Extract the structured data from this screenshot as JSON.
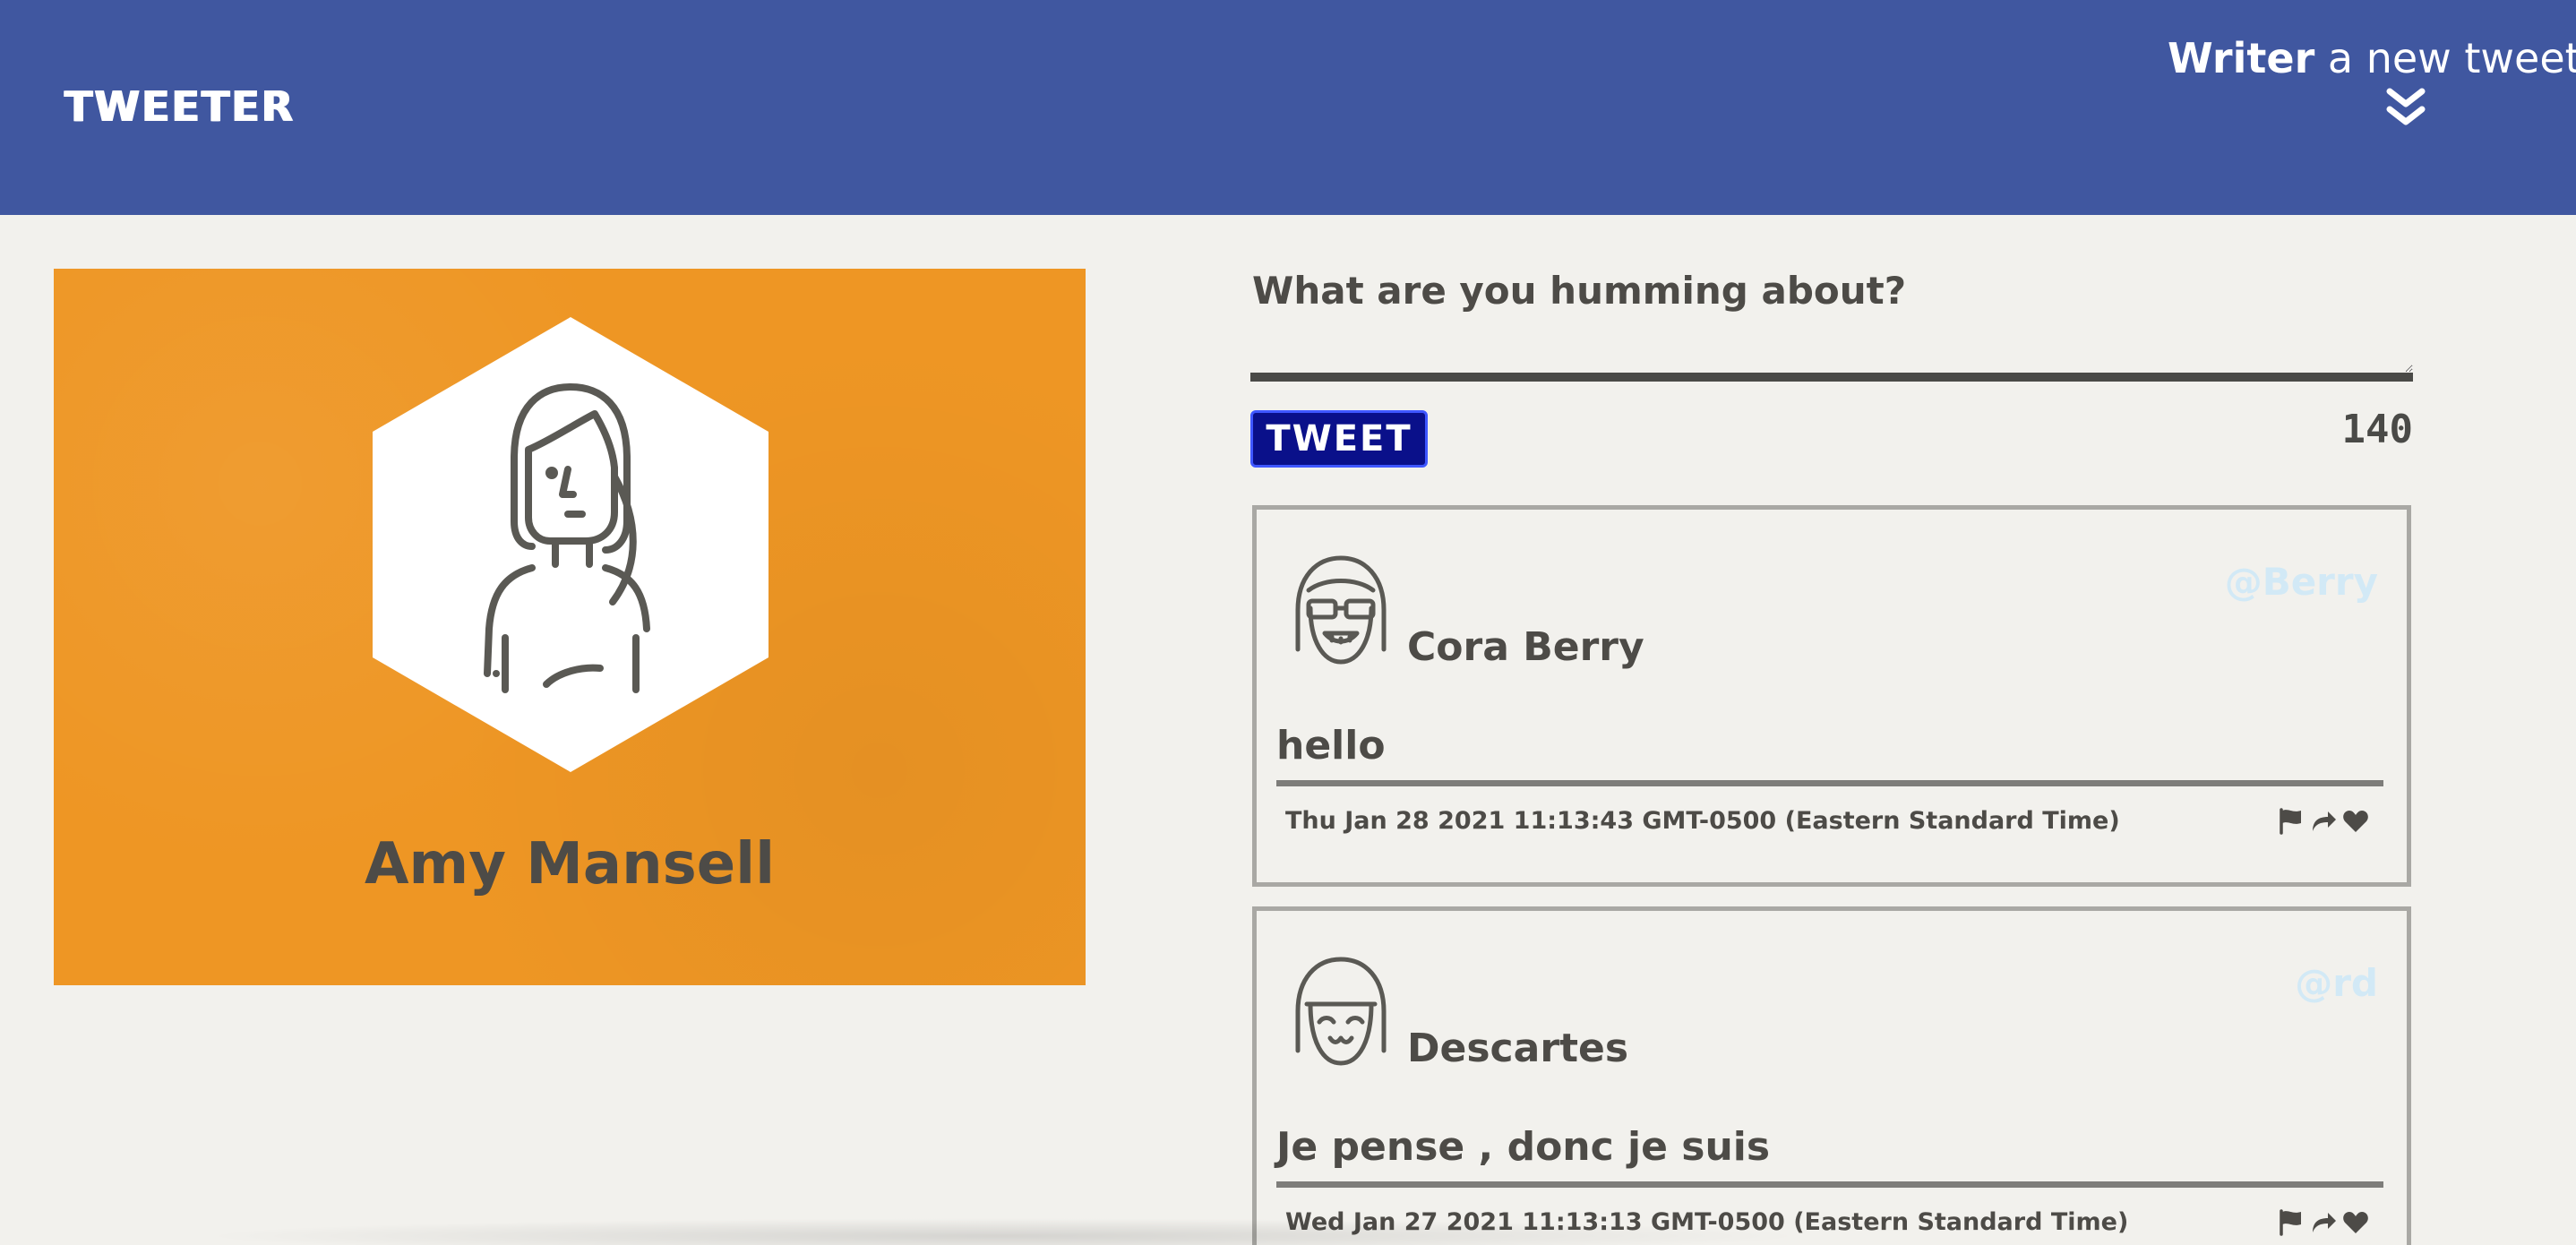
{
  "nav": {
    "brand": "TWEETER",
    "compose_bold": "Writer",
    "compose_rest": "a new tweete",
    "compose_icon": "double-chevron-down-icon"
  },
  "profile": {
    "name": "Amy Mansell",
    "background_color": "#ee9624"
  },
  "composer": {
    "label": "What are you humming about?",
    "input_value": "",
    "button_label": "TWEET",
    "counter": "140",
    "button_color": "#0a108a"
  },
  "tweets": [
    {
      "name": "Cora Berry",
      "handle": "@Berry",
      "text": "hello",
      "date": "Thu Jan 28 2021 11:13:43 GMT-0500 (Eastern Standard Time)",
      "avatar": "sunglasses-avatar-icon"
    },
    {
      "name": "Descartes",
      "handle": "@rd",
      "text": "Je pense , donc je suis",
      "date": "Wed Jan 27 2021 11:13:13 GMT-0500 (Eastern Standard Time)",
      "avatar": "smiling-avatar-icon"
    }
  ],
  "actions": [
    "flag-icon",
    "retweet-icon",
    "heart-icon"
  ],
  "colors": {
    "nav": "#4057a0",
    "page": "#f2f1ed",
    "text": "#4d4b47",
    "handle": "#d2e9f6"
  }
}
